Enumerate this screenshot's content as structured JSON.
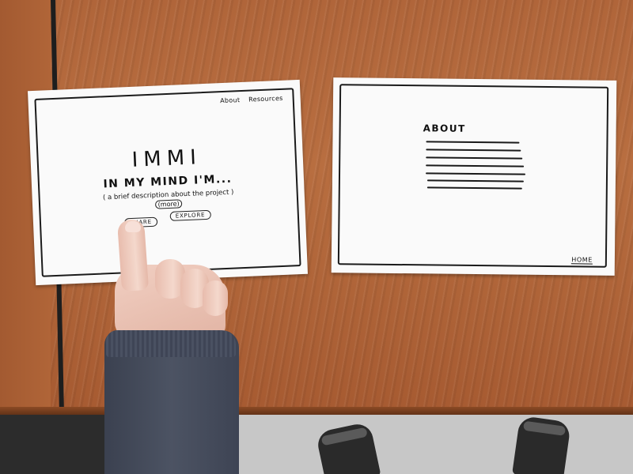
{
  "left_card": {
    "nav_items": [
      "About",
      "Resources"
    ],
    "logo": "IMMI",
    "tagline": "IN MY MIND I'M...",
    "description": "( a brief description about the project )",
    "more_label": "(more)",
    "share_button": "SHARE",
    "explore_button": "EXPLORE"
  },
  "right_card": {
    "title": "ABOUT",
    "home_link": "HOME"
  }
}
